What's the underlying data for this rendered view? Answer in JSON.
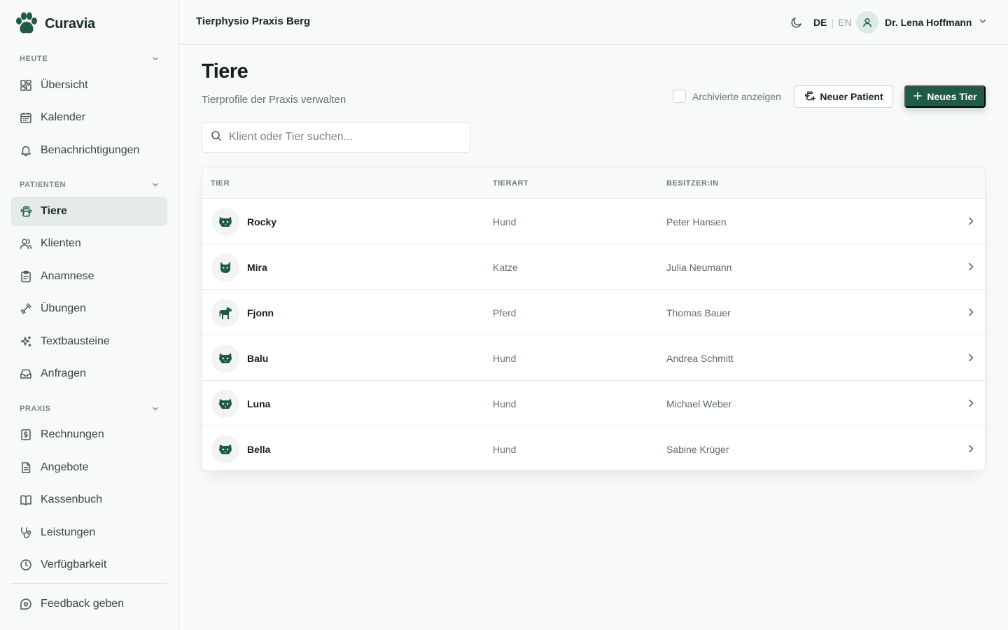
{
  "app": {
    "name": "Curavia"
  },
  "sidebar": {
    "sections": [
      {
        "title": "HEUTE",
        "items": [
          {
            "label": "Übersicht",
            "icon": "dashboard-icon"
          },
          {
            "label": "Kalender",
            "icon": "calendar-icon"
          },
          {
            "label": "Benachrichtigungen",
            "icon": "bell-icon"
          }
        ]
      },
      {
        "title": "PATIENTEN",
        "items": [
          {
            "label": "Tiere",
            "icon": "paw-icon",
            "active": true
          },
          {
            "label": "Klienten",
            "icon": "users-icon"
          },
          {
            "label": "Anamnese",
            "icon": "clipboard-icon"
          },
          {
            "label": "Übungen",
            "icon": "dumbbell-icon"
          },
          {
            "label": "Textbausteine",
            "icon": "sparkles-icon"
          },
          {
            "label": "Anfragen",
            "icon": "inbox-icon"
          }
        ]
      },
      {
        "title": "PRAXIS",
        "items": [
          {
            "label": "Rechnungen",
            "icon": "receipt-icon"
          },
          {
            "label": "Angebote",
            "icon": "document-icon"
          },
          {
            "label": "Kassenbuch",
            "icon": "book-icon"
          },
          {
            "label": "Leistungen",
            "icon": "stethoscope-icon"
          },
          {
            "label": "Verfügbarkeit",
            "icon": "clock-icon"
          }
        ]
      }
    ],
    "feedback": {
      "label": "Feedback geben",
      "icon": "feedback-icon"
    }
  },
  "header": {
    "practice": "Tierphysio Praxis Berg",
    "lang_active": "DE",
    "lang_sep": "|",
    "lang_other": "EN",
    "user": "Dr. Lena Hoffmann"
  },
  "page": {
    "title": "Tiere",
    "subtitle": "Tierprofile der Praxis verwalten",
    "archive_label": "Archivierte anzeigen",
    "new_patient": "Neuer Patient",
    "new_animal": "Neues Tier",
    "search_placeholder": "Klient oder Tier suchen..."
  },
  "table": {
    "columns": [
      "TIER",
      "TIERART",
      "BESITZER:IN"
    ],
    "rows": [
      {
        "name": "Rocky",
        "species": "Hund",
        "owner": "Peter Hansen",
        "icon": "dog-icon"
      },
      {
        "name": "Mira",
        "species": "Katze",
        "owner": "Julia Neumann",
        "icon": "cat-icon"
      },
      {
        "name": "Fjonn",
        "species": "Pferd",
        "owner": "Thomas Bauer",
        "icon": "horse-icon"
      },
      {
        "name": "Balu",
        "species": "Hund",
        "owner": "Andrea Schmitt",
        "icon": "dog-icon"
      },
      {
        "name": "Luna",
        "species": "Hund",
        "owner": "Michael Weber",
        "icon": "dog-icon"
      },
      {
        "name": "Bella",
        "species": "Hund",
        "owner": "Sabine Krüger",
        "icon": "dog-icon"
      }
    ]
  },
  "colors": {
    "brand": "#1e5a45",
    "active_nav": "#e4ebe9"
  }
}
